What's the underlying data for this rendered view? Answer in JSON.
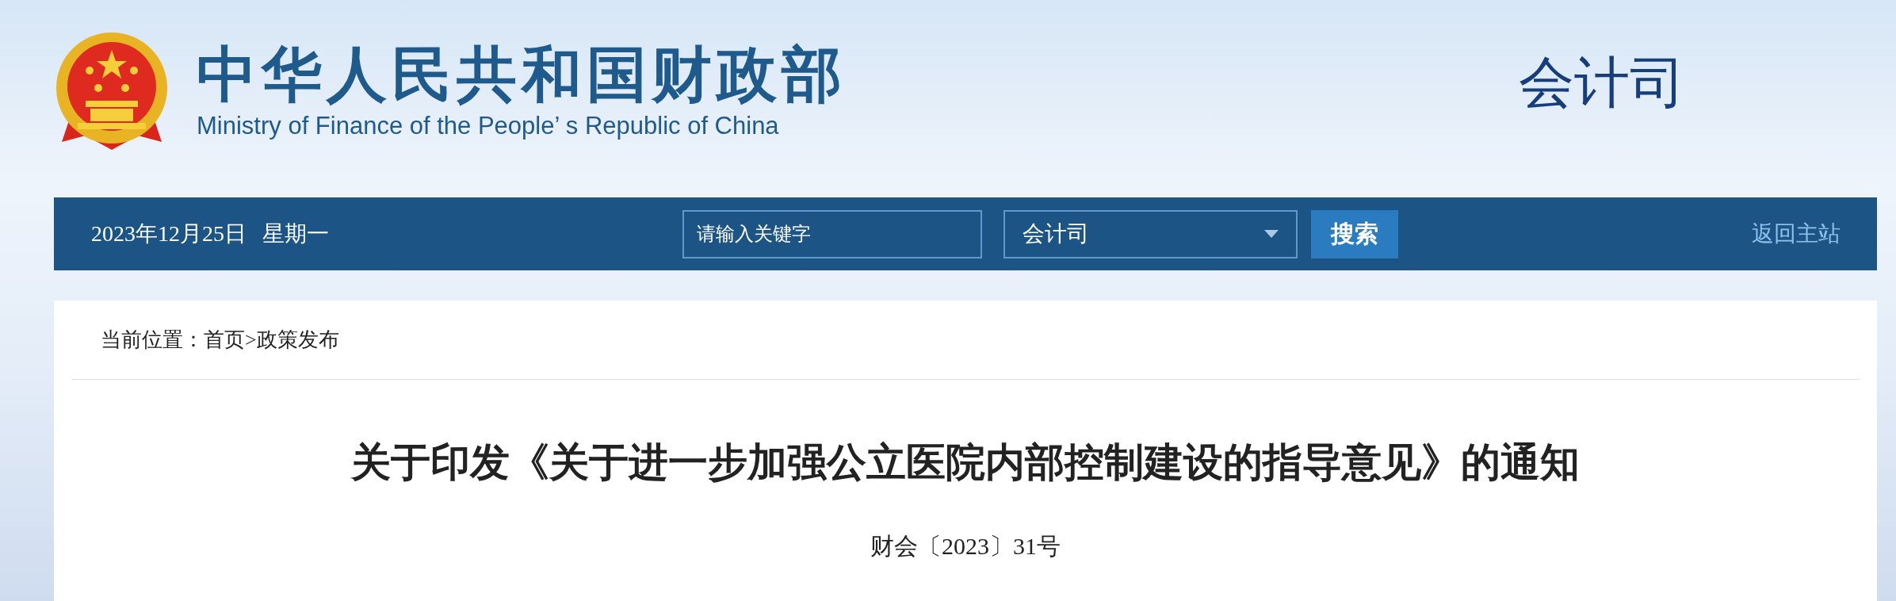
{
  "header": {
    "title_zh": "中华人民共和国财政部",
    "title_en": "Ministry of Finance of the People’ s Republic of China",
    "department": "会计司"
  },
  "nav_bar": {
    "date": "2023年12月25日",
    "weekday": "星期一",
    "search": {
      "placeholder": "请输入关键字"
    },
    "scope_select": {
      "value": "会计司"
    },
    "search_button": "搜索",
    "home_link": "返回主站"
  },
  "breadcrumb": {
    "label": "当前位置：",
    "links": [
      "首页",
      "政策发布"
    ],
    "separator": ">"
  },
  "article": {
    "title": "关于印发《关于进一步加强公立医院内部控制建设的指导意见》的通知",
    "doc_number": "财会〔2023〕31号"
  }
}
